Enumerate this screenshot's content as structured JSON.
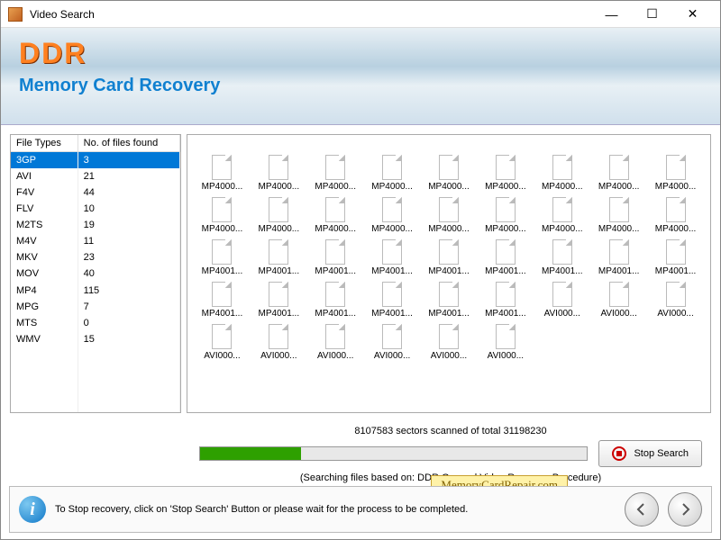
{
  "window": {
    "title": "Video Search",
    "minimize": "—",
    "maximize": "☐",
    "close": "✕"
  },
  "header": {
    "brand": "DDR",
    "subtitle": "Memory Card Recovery"
  },
  "file_types": {
    "col1": "File Types",
    "col2": "No. of files found",
    "rows": [
      {
        "type": "3GP",
        "count": "3",
        "selected": true
      },
      {
        "type": "AVI",
        "count": "21"
      },
      {
        "type": "F4V",
        "count": "44"
      },
      {
        "type": "FLV",
        "count": "10"
      },
      {
        "type": "M2TS",
        "count": "19"
      },
      {
        "type": "M4V",
        "count": "11"
      },
      {
        "type": "MKV",
        "count": "23"
      },
      {
        "type": "MOV",
        "count": "40"
      },
      {
        "type": "MP4",
        "count": "115"
      },
      {
        "type": "MPG",
        "count": "7"
      },
      {
        "type": "MTS",
        "count": "0"
      },
      {
        "type": "WMV",
        "count": "15"
      }
    ]
  },
  "files_grid": {
    "row1": [
      "MP4000...",
      "MP4000...",
      "MP4000...",
      "MP4000...",
      "MP4000...",
      "MP4000...",
      "MP4000...",
      "MP4000...",
      "MP4000..."
    ],
    "row2": [
      "MP4000...",
      "MP4000...",
      "MP4000...",
      "MP4000...",
      "MP4000...",
      "MP4000...",
      "MP4000...",
      "MP4000...",
      "MP4000..."
    ],
    "row3": [
      "MP4001...",
      "MP4001...",
      "MP4001...",
      "MP4001...",
      "MP4001...",
      "MP4001...",
      "MP4001...",
      "MP4001...",
      "MP4001..."
    ],
    "row4": [
      "MP4001...",
      "MP4001...",
      "MP4001...",
      "MP4001...",
      "MP4001...",
      "MP4001...",
      "AVI000...",
      "AVI000...",
      "AVI000..."
    ],
    "row5": [
      "AVI000...",
      "AVI000...",
      "AVI000...",
      "AVI000...",
      "AVI000...",
      "AVI000...",
      "",
      "",
      ""
    ]
  },
  "progress": {
    "status": "8107583 sectors scanned of total 31198230",
    "note": "(Searching files based on:  DDR General Video Recovery Procedure)",
    "stop_label": "Stop Search"
  },
  "footer": {
    "text": "To Stop recovery, click on 'Stop Search' Button or please wait for the process to be completed."
  },
  "watermark": "MemoryCardRepair.com"
}
